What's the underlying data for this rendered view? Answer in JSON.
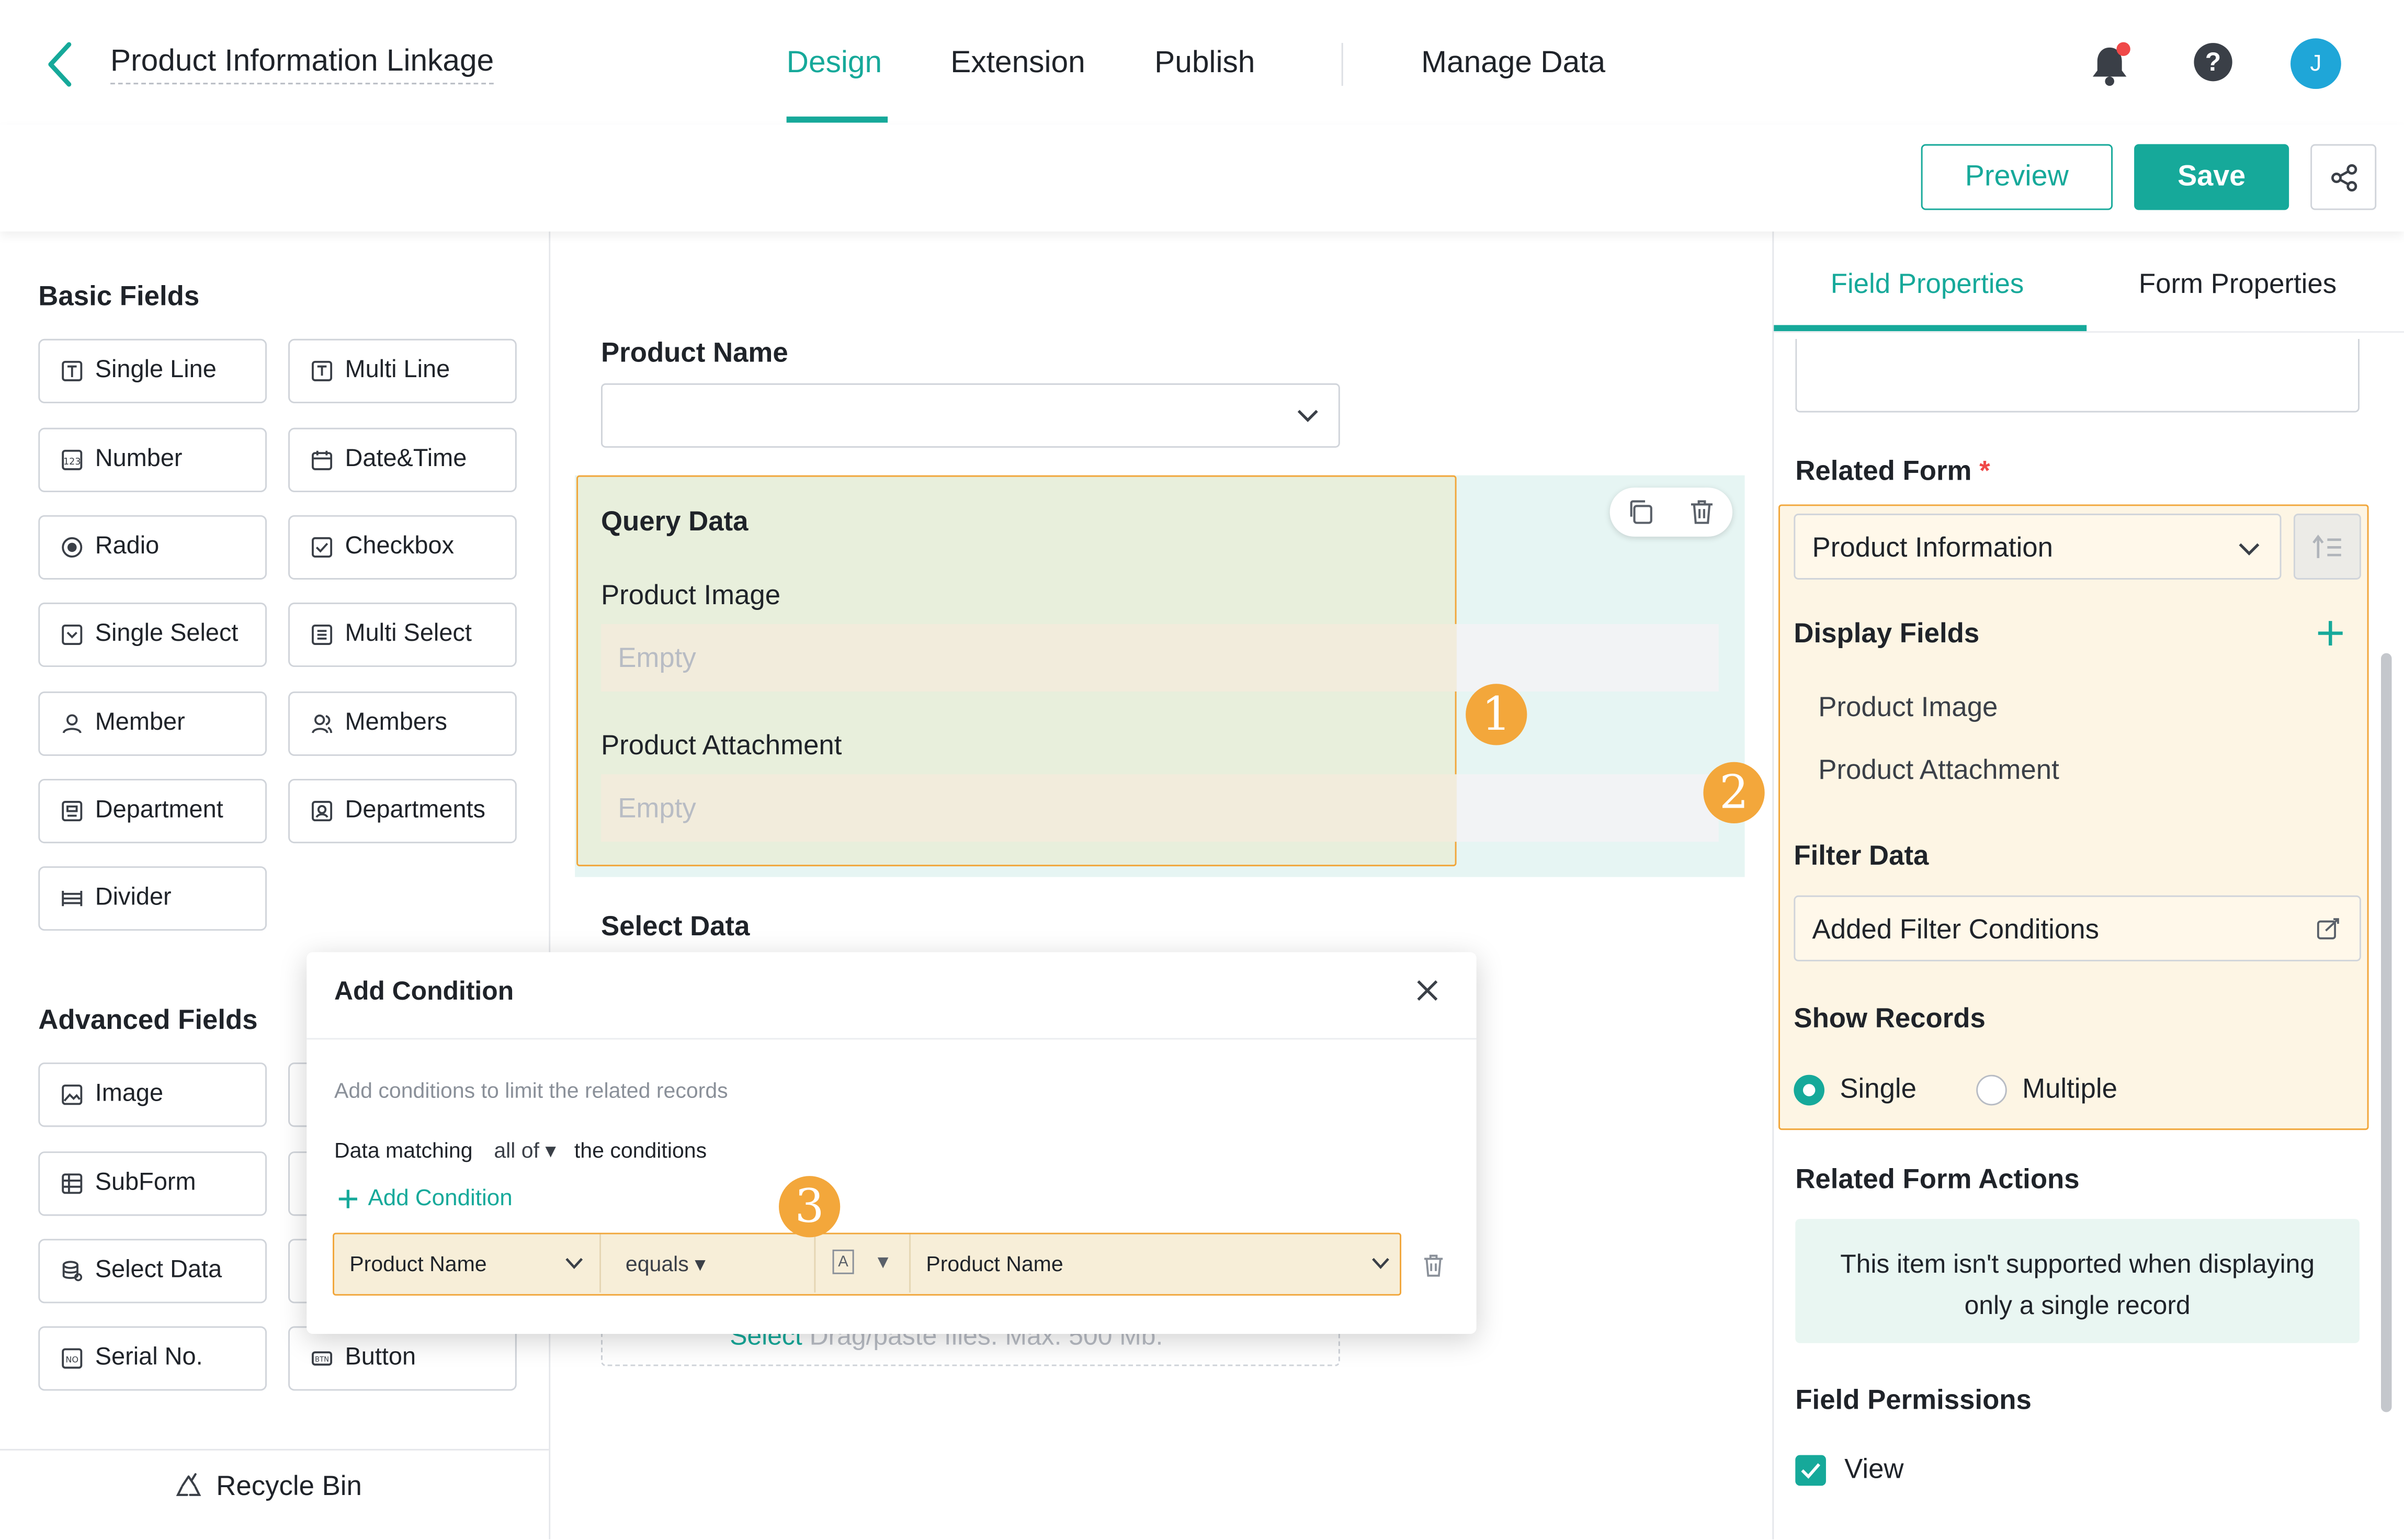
{
  "header": {
    "back_icon": "chevron-left-icon",
    "app_title": "Product Information Linkage",
    "tabs": [
      {
        "label": "Design",
        "active": true
      },
      {
        "label": "Extension",
        "active": false
      },
      {
        "label": "Publish",
        "active": false
      },
      {
        "label": "Manage Data",
        "active": false
      }
    ],
    "avatar_initial": "J",
    "accent_color": "#16a99a"
  },
  "toolbar": {
    "preview_label": "Preview",
    "save_label": "Save"
  },
  "left_panel": {
    "basic_title": "Basic Fields",
    "basic_fields": [
      "Single Line",
      "Multi Line",
      "Number",
      "Date&Time",
      "Radio",
      "Checkbox",
      "Single Select",
      "Multi Select",
      "Member",
      "Members",
      "Department",
      "Departments",
      "Divider"
    ],
    "advanced_title": "Advanced Fields",
    "advanced_fields": [
      "Image",
      "SubForm",
      "Select Data",
      "Serial No.",
      "Button"
    ],
    "recycle_label": "Recycle Bin"
  },
  "canvas": {
    "product_name_label": "Product Name",
    "query_title": "Query Data",
    "product_image_label": "Product Image",
    "empty_text": "Empty",
    "product_attachment_label": "Product Attachment",
    "select_data_label": "Select Data",
    "upload_link": "Select",
    "upload_hint": "Drag/paste files. Max. 500 Mb."
  },
  "modal": {
    "title": "Add Condition",
    "description": "Add conditions to limit the related records",
    "matching_prefix": "Data matching",
    "matching_value": "all of",
    "matching_suffix": "the conditions",
    "add_condition_label": "Add Condition",
    "condition": {
      "field": "Product Name",
      "operator": "equals",
      "type_glyph": "A",
      "value": "Product Name"
    }
  },
  "right_panel": {
    "tabs": [
      {
        "label": "Field Properties",
        "active": true
      },
      {
        "label": "Form Properties",
        "active": false
      }
    ],
    "related_form_label": "Related Form",
    "required_mark": "*",
    "related_form_value": "Product Information",
    "display_fields_label": "Display Fields",
    "display_fields": [
      "Product Image",
      "Product Attachment"
    ],
    "filter_data_label": "Filter Data",
    "filter_value": "Added Filter Conditions",
    "show_records_label": "Show Records",
    "show_records_options": [
      {
        "label": "Single",
        "checked": true
      },
      {
        "label": "Multiple",
        "checked": false
      }
    ],
    "related_actions_label": "Related Form Actions",
    "related_actions_note": "This item isn't supported when displaying only a single record",
    "permissions_label": "Field Permissions",
    "permission_view": "View"
  },
  "badges": [
    "1",
    "2",
    "3"
  ]
}
